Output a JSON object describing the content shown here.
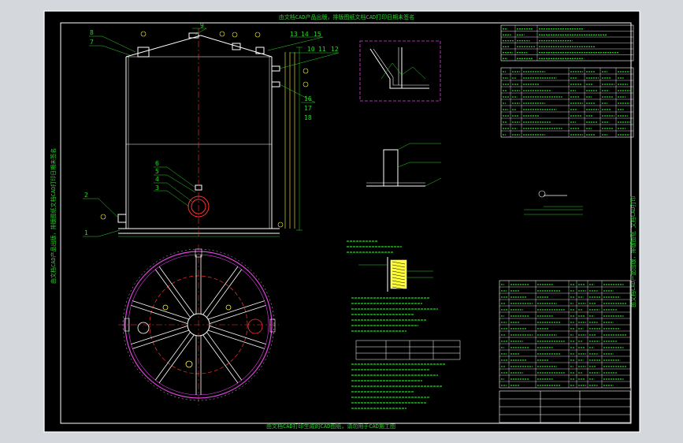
{
  "colors": {
    "paper": "#000000",
    "frame": "#ffffff",
    "tank": "#ffffff",
    "green": "#2bd42b",
    "yellow": "#ffff33",
    "magenta": "#e040e0",
    "red": "#ff3030",
    "cyan": "#00e5ff",
    "viewport_bg": "#d4d8dd"
  },
  "labels": {
    "top_banner": "由文档CAD产品出版，排版图纸文档CAD打印日期未签名",
    "bottom_banner": "由文档CAD打印生成的CAD图纸，请勿用于CAD施工图",
    "left_banner": "由文档CAD产品出版，排版图纸文档CAD打印日期未签名",
    "right_banner": "由文档CAD产品出版，排版图纸 文档CAD打印",
    "callout_1": "1",
    "callout_2": "2",
    "callout_3": "3",
    "callout_4": "4",
    "callout_5": "5",
    "callout_6": "6",
    "callout_7": "7",
    "callout_8": "8",
    "callout_9": "9",
    "callout_10": "10",
    "callout_11": "11",
    "callout_12": "12",
    "callout_13": "13",
    "callout_14": "14",
    "callout_15": "15",
    "callout_16": "16",
    "callout_17": "17",
    "callout_18": "18"
  }
}
